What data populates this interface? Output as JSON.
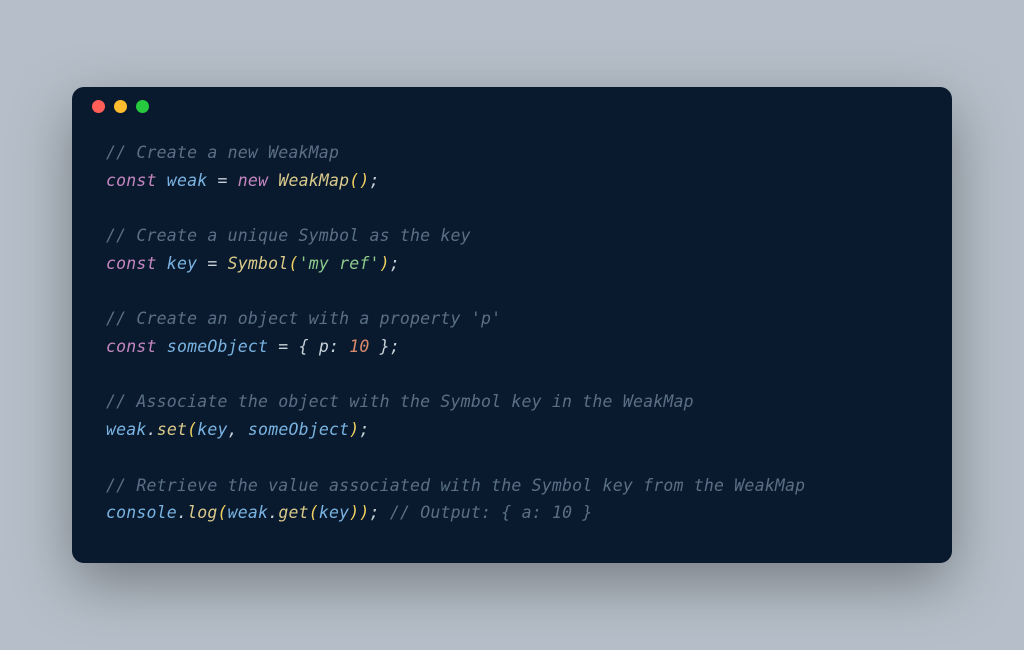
{
  "window": {
    "dots": [
      "red",
      "yellow",
      "green"
    ]
  },
  "colors": {
    "bg_page": "#b6bfc9",
    "bg_editor": "#091a2e",
    "dot_red": "#ff5f56",
    "dot_yellow": "#ffbd2e",
    "dot_green": "#27c93f",
    "comment": "#5a6f85",
    "keyword": "#c586c0",
    "variable": "#7ab3e1",
    "classname": "#d9c98a",
    "paren": "#f0d060",
    "string": "#8cc98c",
    "number": "#d88a6b",
    "method": "#d9c98a",
    "plain": "#c9d1d9"
  },
  "code": {
    "l1_comment": "// Create a new WeakMap",
    "l2_const": "const",
    "l2_var": " weak ",
    "l2_eq": "= ",
    "l2_new": "new",
    "l2_sp": " ",
    "l2_class": "WeakMap",
    "l2_open": "(",
    "l2_close": ")",
    "l2_semi": ";",
    "l4_comment": "// Create a unique Symbol as the key",
    "l5_const": "const",
    "l5_var": " key ",
    "l5_eq": "= ",
    "l5_class": "Symbol",
    "l5_open": "(",
    "l5_str": "'my ref'",
    "l5_close": ")",
    "l5_semi": ";",
    "l7_comment": "// Create an object with a property 'p'",
    "l8_const": "const",
    "l8_var": " someObject ",
    "l8_eq": "= ",
    "l8_lb": "{ ",
    "l8_prop": "p",
    "l8_colon": ": ",
    "l8_num": "10",
    "l8_rb": " }",
    "l8_semi": ";",
    "l10_comment": "// Associate the object with the Symbol key in the WeakMap",
    "l11_obj": "weak",
    "l11_dot": ".",
    "l11_method": "set",
    "l11_open": "(",
    "l11_arg1": "key",
    "l11_comma": ", ",
    "l11_arg2": "someObject",
    "l11_close": ")",
    "l11_semi": ";",
    "l13_comment": "// Retrieve the value associated with the Symbol key from the WeakMap",
    "l14_obj": "console",
    "l14_dot1": ".",
    "l14_method1": "log",
    "l14_open1": "(",
    "l14_obj2": "weak",
    "l14_dot2": ".",
    "l14_method2": "get",
    "l14_open2": "(",
    "l14_arg": "key",
    "l14_close2": ")",
    "l14_close1": ")",
    "l14_semi": ";",
    "l14_sp": " ",
    "l14_outcomment": "// Output: { a: 10 }"
  }
}
